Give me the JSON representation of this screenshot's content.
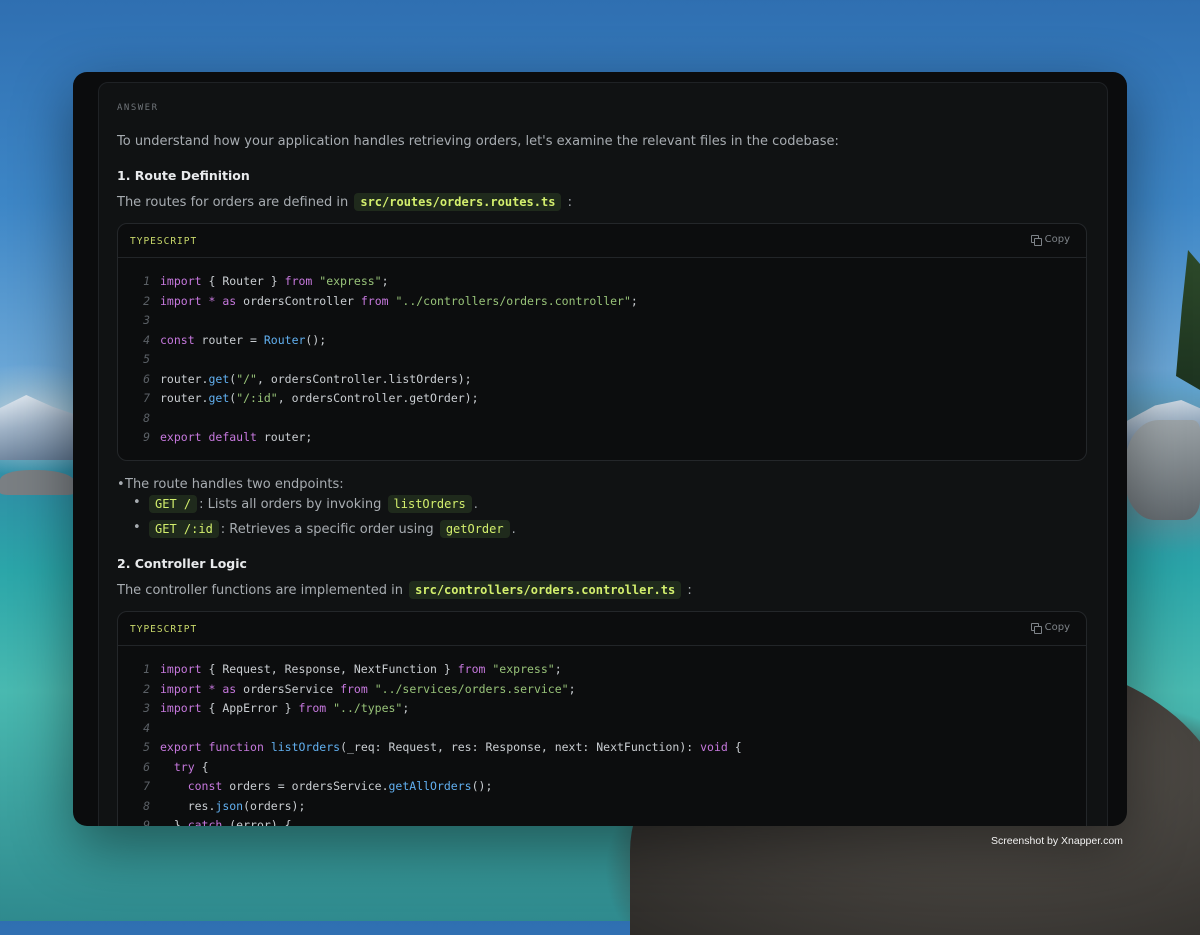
{
  "answer_label": "ANSWER",
  "intro": "To understand how your application handles retrieving orders, let's examine the relevant files in the codebase:",
  "section1": {
    "heading": "1. Route Definition",
    "lead_before": "The routes for orders are defined in",
    "file": "src/routes/orders.routes.ts",
    "lead_after": ":",
    "code": {
      "language": "TYPESCRIPT",
      "copy_label": "Copy",
      "lines": [
        {
          "n": "1",
          "t": [
            [
              "kw",
              "import"
            ],
            [
              "id",
              " { Router } "
            ],
            [
              "kw",
              "from"
            ],
            [
              "id",
              " "
            ],
            [
              "str",
              "\"express\""
            ],
            [
              "id",
              ";"
            ]
          ]
        },
        {
          "n": "2",
          "t": [
            [
              "kw",
              "import"
            ],
            [
              "id",
              " "
            ],
            [
              "kw",
              "*"
            ],
            [
              "id",
              " "
            ],
            [
              "kw",
              "as"
            ],
            [
              "id",
              " ordersController "
            ],
            [
              "kw",
              "from"
            ],
            [
              "id",
              " "
            ],
            [
              "str",
              "\"../controllers/orders.controller\""
            ],
            [
              "id",
              ";"
            ]
          ]
        },
        {
          "n": "3",
          "t": []
        },
        {
          "n": "4",
          "t": [
            [
              "kw",
              "const"
            ],
            [
              "id",
              " router = "
            ],
            [
              "fn",
              "Router"
            ],
            [
              "id",
              "();"
            ]
          ]
        },
        {
          "n": "5",
          "t": []
        },
        {
          "n": "6",
          "t": [
            [
              "id",
              "router."
            ],
            [
              "fn",
              "get"
            ],
            [
              "id",
              "("
            ],
            [
              "str",
              "\"/\""
            ],
            [
              "id",
              ", ordersController.listOrders);"
            ]
          ]
        },
        {
          "n": "7",
          "t": [
            [
              "id",
              "router."
            ],
            [
              "fn",
              "get"
            ],
            [
              "id",
              "("
            ],
            [
              "str",
              "\"/:id\""
            ],
            [
              "id",
              ", ordersController.getOrder);"
            ]
          ]
        },
        {
          "n": "8",
          "t": []
        },
        {
          "n": "9",
          "t": [
            [
              "kw",
              "export"
            ],
            [
              "id",
              " "
            ],
            [
              "kw",
              "default"
            ],
            [
              "id",
              " router;"
            ]
          ]
        }
      ]
    },
    "bullet": "The route handles two endpoints:",
    "sub1": {
      "code": "GET /",
      "text": ": Lists all orders by invoking",
      "ref": "listOrders",
      "end": "."
    },
    "sub2": {
      "code": "GET /:id",
      "text": ": Retrieves a specific order using",
      "ref": "getOrder",
      "end": "."
    }
  },
  "section2": {
    "heading": "2. Controller Logic",
    "lead_before": "The controller functions are implemented in",
    "file": "src/controllers/orders.controller.ts",
    "lead_after": ":",
    "code": {
      "language": "TYPESCRIPT",
      "copy_label": "Copy",
      "lines": [
        {
          "n": "1",
          "t": [
            [
              "kw",
              "import"
            ],
            [
              "id",
              " { Request, Response, NextFunction } "
            ],
            [
              "kw",
              "from"
            ],
            [
              "id",
              " "
            ],
            [
              "str",
              "\"express\""
            ],
            [
              "id",
              ";"
            ]
          ]
        },
        {
          "n": "2",
          "t": [
            [
              "kw",
              "import"
            ],
            [
              "id",
              " "
            ],
            [
              "kw",
              "*"
            ],
            [
              "id",
              " "
            ],
            [
              "kw",
              "as"
            ],
            [
              "id",
              " ordersService "
            ],
            [
              "kw",
              "from"
            ],
            [
              "id",
              " "
            ],
            [
              "str",
              "\"../services/orders.service\""
            ],
            [
              "id",
              ";"
            ]
          ]
        },
        {
          "n": "3",
          "t": [
            [
              "kw",
              "import"
            ],
            [
              "id",
              " { AppError } "
            ],
            [
              "kw",
              "from"
            ],
            [
              "id",
              " "
            ],
            [
              "str",
              "\"../types\""
            ],
            [
              "id",
              ";"
            ]
          ]
        },
        {
          "n": "4",
          "t": []
        },
        {
          "n": "5",
          "t": [
            [
              "kw",
              "export"
            ],
            [
              "id",
              " "
            ],
            [
              "kw",
              "function"
            ],
            [
              "id",
              " "
            ],
            [
              "fn",
              "listOrders"
            ],
            [
              "id",
              "(_req: Request, res: Response, next: NextFunction): "
            ],
            [
              "kw",
              "void"
            ],
            [
              "id",
              " {"
            ]
          ]
        },
        {
          "n": "6",
          "t": [
            [
              "id",
              "  "
            ],
            [
              "kw",
              "try"
            ],
            [
              "id",
              " {"
            ]
          ]
        },
        {
          "n": "7",
          "t": [
            [
              "id",
              "    "
            ],
            [
              "kw",
              "const"
            ],
            [
              "id",
              " orders = ordersService."
            ],
            [
              "fn",
              "getAllOrders"
            ],
            [
              "id",
              "();"
            ]
          ]
        },
        {
          "n": "8",
          "t": [
            [
              "id",
              "    res."
            ],
            [
              "fn",
              "json"
            ],
            [
              "id",
              "(orders);"
            ]
          ]
        },
        {
          "n": "9",
          "t": [
            [
              "id",
              "  } "
            ],
            [
              "kw",
              "catch"
            ],
            [
              "id",
              " (error) {"
            ]
          ]
        }
      ]
    }
  },
  "watermark": "Screenshot by Xnapper.com"
}
